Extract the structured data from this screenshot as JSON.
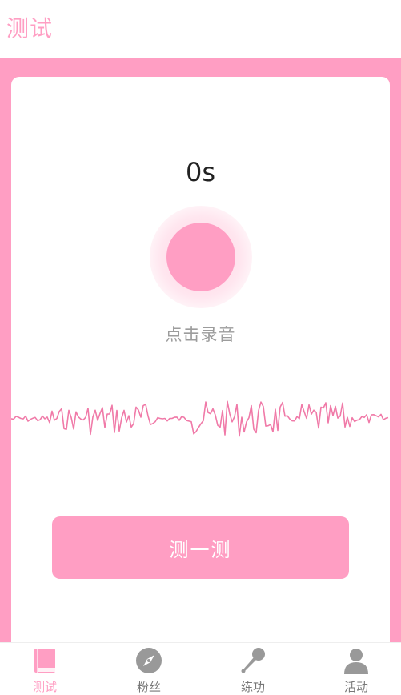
{
  "header": {
    "title": "测试"
  },
  "recorder": {
    "timer": "0s",
    "hint": "点击录音",
    "accent_color": "#ff9ec3"
  },
  "actions": {
    "test_label": "测一测"
  },
  "tabbar": {
    "active_color": "#ff9ec3",
    "inactive_color": "#999999",
    "items": [
      {
        "label": "测试",
        "icon": "book-icon",
        "active": true
      },
      {
        "label": "粉丝",
        "icon": "compass-icon",
        "active": false
      },
      {
        "label": "练功",
        "icon": "microphone-icon",
        "active": false
      },
      {
        "label": "活动",
        "icon": "user-icon",
        "active": false
      }
    ]
  }
}
